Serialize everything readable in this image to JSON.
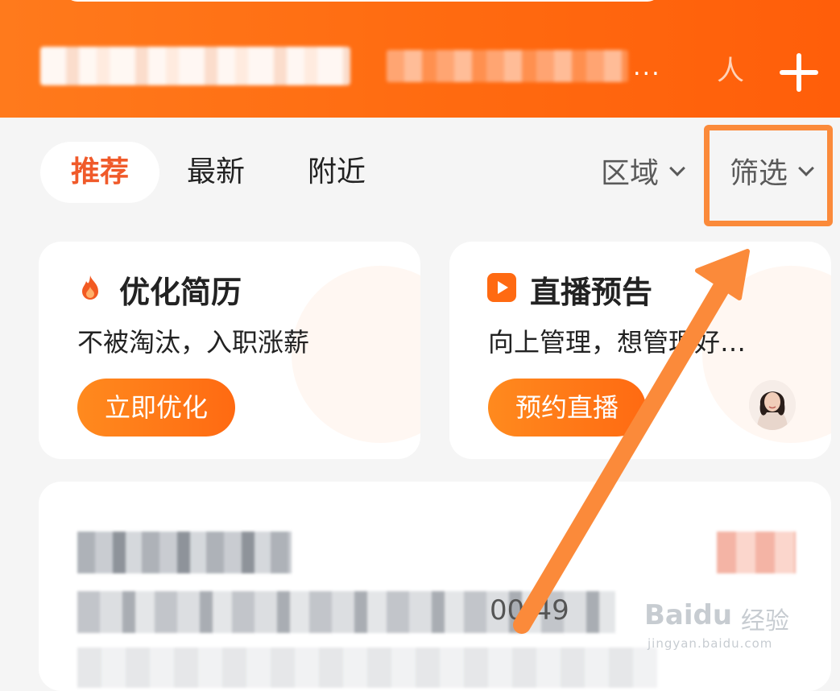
{
  "header": {
    "title": "行政专员/助理",
    "subtitle_ellipsis": "...",
    "faint_icon_glyph": "人",
    "bg_color": "#ff6a10"
  },
  "tabs": [
    {
      "label": "推荐",
      "active": true
    },
    {
      "label": "最新",
      "active": false
    },
    {
      "label": "附近",
      "active": false
    }
  ],
  "filters": {
    "region_label": "区域",
    "filter_label": "筛选",
    "highlight_color": "#fb8a3a"
  },
  "cards": [
    {
      "icon": "fire-icon",
      "title": "优化简历",
      "description": "不被淘汰，入职涨薪",
      "button_label": "立即优化"
    },
    {
      "icon": "play-icon",
      "title": "直播预告",
      "description": "向上管理，想管理好…",
      "button_label": "预约直播"
    }
  ],
  "job_listing": {
    "salary_visible": "00-49"
  },
  "watermark": {
    "brand": "Bai",
    "brand_suffix": "du",
    "cn": "经验",
    "url": "jingyan.baidu.com"
  },
  "colors": {
    "accent": "#f05a2a",
    "button_gradient_start": "#ff8a1e",
    "button_gradient_end": "#ff6a12"
  }
}
